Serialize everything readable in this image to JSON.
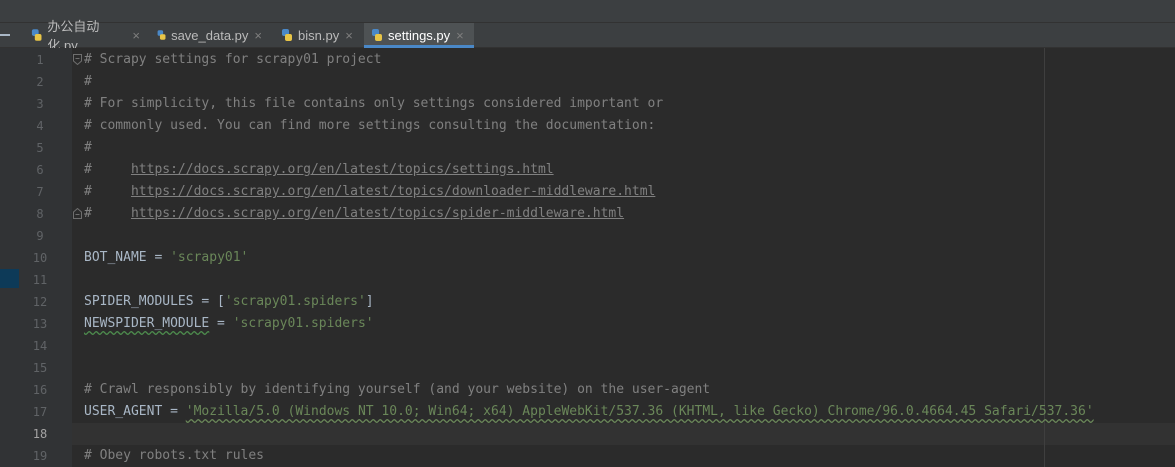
{
  "tabs": [
    {
      "label": "办公自动化.py",
      "active": false
    },
    {
      "label": "save_data.py",
      "active": false
    },
    {
      "label": "bisn.py",
      "active": false
    },
    {
      "label": "settings.py",
      "active": true
    }
  ],
  "close_glyph": "×",
  "lines": [
    {
      "n": "1",
      "comment": "# Scrapy settings for scrapy01 project"
    },
    {
      "n": "2",
      "comment": "#"
    },
    {
      "n": "3",
      "comment": "# For simplicity, this file contains only settings considered important or"
    },
    {
      "n": "4",
      "comment": "# commonly used. You can find more settings consulting the documentation:"
    },
    {
      "n": "5",
      "comment": "#"
    },
    {
      "n": "6",
      "prefix": "#     ",
      "url": "https://docs.scrapy.org/en/latest/topics/settings.html"
    },
    {
      "n": "7",
      "prefix": "#     ",
      "url": "https://docs.scrapy.org/en/latest/topics/downloader-middleware.html"
    },
    {
      "n": "8",
      "prefix": "#     ",
      "url": "https://docs.scrapy.org/en/latest/topics/spider-middleware.html"
    },
    {
      "n": "9"
    },
    {
      "n": "10",
      "name": "BOT_NAME",
      "op": " = ",
      "value": "'scrapy01'"
    },
    {
      "n": "11"
    },
    {
      "n": "12",
      "name": "SPIDER_MODULES",
      "op": " = [",
      "value": "'scrapy01.spiders'",
      "suffix": "]"
    },
    {
      "n": "13",
      "name": "NEWSPIDER_MODULE",
      "op": " = ",
      "value": "'scrapy01.spiders'"
    },
    {
      "n": "14"
    },
    {
      "n": "15"
    },
    {
      "n": "16",
      "comment": "# Crawl responsibly by identifying yourself (and your website) on the user-agent"
    },
    {
      "n": "17",
      "name": "USER_AGENT",
      "op": " = ",
      "value": "'Mozilla/5.0 (Windows NT 10.0; Win64; x64) AppleWebKit/537.36 (KHTML, like Gecko) Chrome/96.0.4664.45 Safari/537.36'"
    },
    {
      "n": "18"
    },
    {
      "n": "19",
      "comment": "# Obey robots.txt rules"
    }
  ],
  "current_line": "18",
  "colors": {
    "background": "#2b2b2b",
    "comment": "#808080",
    "string": "#6a8759",
    "text": "#a9b7c6",
    "accent": "#4a88c7"
  }
}
